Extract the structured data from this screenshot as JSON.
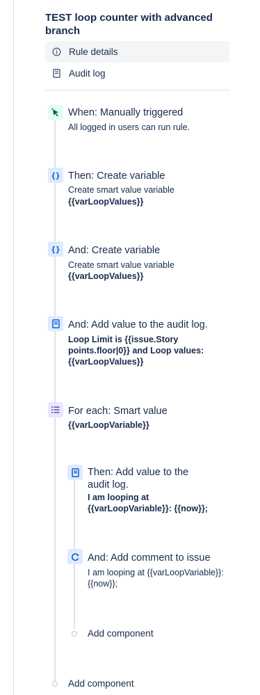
{
  "rule": {
    "title": "TEST loop counter with advanced branch"
  },
  "nav": {
    "rule_details": {
      "label": "Rule details",
      "icon": "info-icon"
    },
    "audit_log": {
      "label": "Audit log",
      "icon": "document-icon"
    }
  },
  "components": {
    "trigger": {
      "title": "When: Manually triggered",
      "description": "All logged in users can run rule.",
      "icon": "cursor-click-icon"
    },
    "create_var_1": {
      "title": "Then: Create variable",
      "description": "Create smart value variable",
      "value": "{{varLoopValues}}",
      "icon": "braces-icon"
    },
    "create_var_2": {
      "title": "And: Create variable",
      "description": "Create smart value variable",
      "value": "{{varLoopValues}}",
      "icon": "braces-icon"
    },
    "audit_log_action": {
      "title": "And: Add value to the audit log.",
      "description": "Loop Limit is {{issue.Story points.floor|0}} and Loop values: {{varLoopValues}}",
      "icon": "document-icon"
    },
    "for_each": {
      "title": "For each: Smart value",
      "description": "{{varLoopVariable}}",
      "icon": "list-icon"
    },
    "branch_audit": {
      "title": "Then: Add value to the audit log.",
      "description": "I am looping at {{varLoopVariable}}: {{now}};",
      "icon": "document-icon"
    },
    "branch_comment": {
      "title": "And: Add comment to issue",
      "description": "I am looping at {{varLoopVariable}}: {{now}};",
      "icon": "comment-refresh-icon"
    }
  },
  "add_component": {
    "branch_label": "Add component",
    "main_label": "Add component"
  },
  "colors": {
    "trigger_bg": "#e3fcef",
    "action_bg": "#deebff",
    "branch_bg": "#eae6ff",
    "text": "#172b4d",
    "line": "#dfe1e6"
  }
}
